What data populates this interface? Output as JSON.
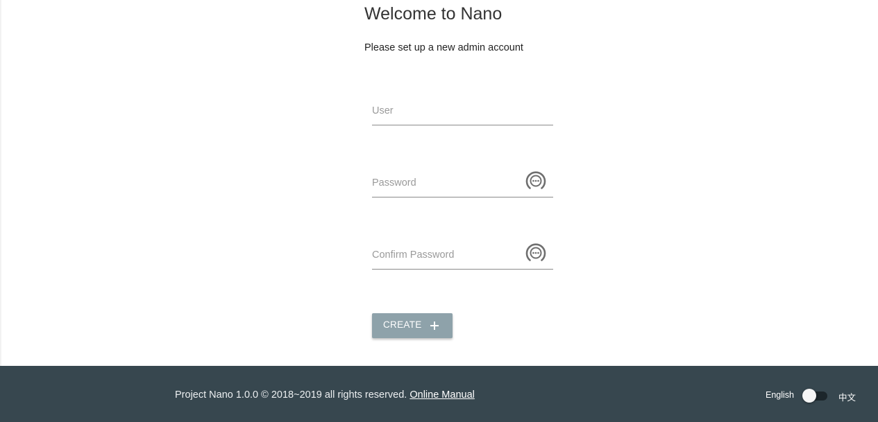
{
  "header": {
    "title": "Welcome to Nano",
    "subtitle": "Please set up a new admin account"
  },
  "form": {
    "user": {
      "placeholder": "User",
      "value": ""
    },
    "password": {
      "placeholder": "Password",
      "value": "",
      "icon": "visibility-toggle-icon"
    },
    "confirm_password": {
      "placeholder": "Confirm Password",
      "value": "",
      "icon": "visibility-toggle-icon"
    },
    "create_button": {
      "label": "CREATE",
      "icon": "plus-icon"
    }
  },
  "footer": {
    "copyright": "Project Nano 1.0.0 © 2018~2019 all rights reserved.",
    "manual_link": "Online Manual",
    "language": {
      "left_label": "English",
      "right_label": "中文",
      "selected": "English"
    }
  },
  "colors": {
    "footer_bg": "#37474f",
    "button_bg": "#8ea2aa",
    "text_primary": "#333333"
  }
}
